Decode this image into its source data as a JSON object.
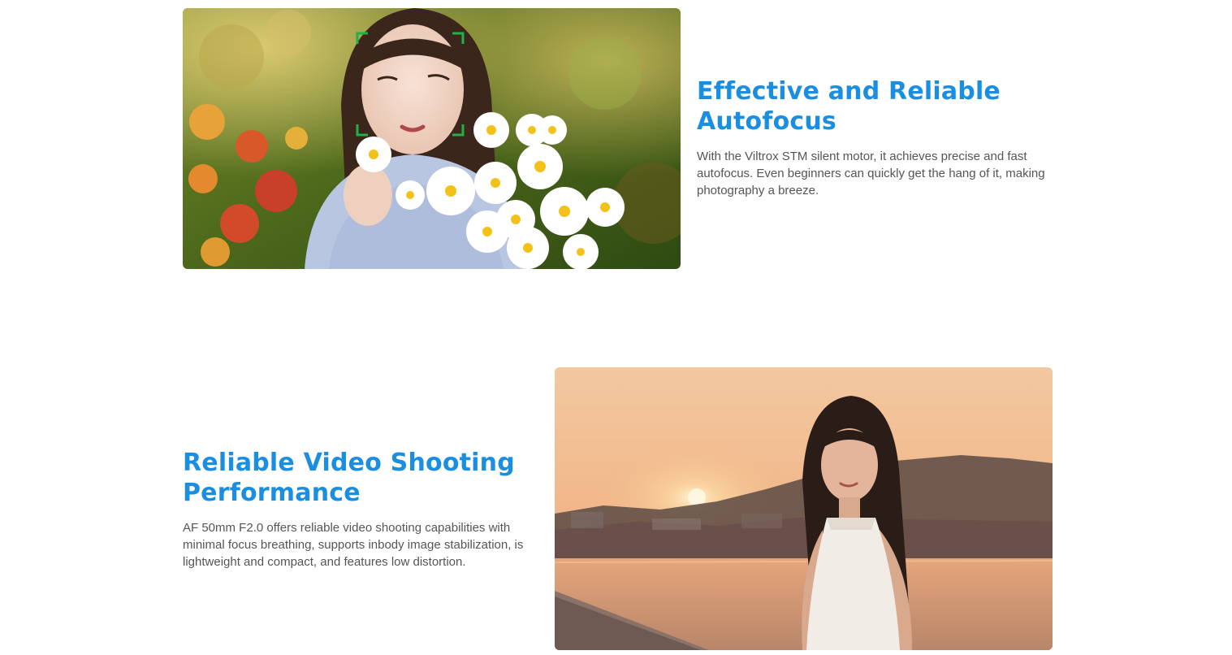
{
  "sections": [
    {
      "title": "Effective and Reliable Autofocus",
      "description": "With the Viltrox STM silent motor, it achieves precise and fast autofocus. Even beginners can quickly get the hang of it, making photography a breeze.",
      "image": "portrait-with-daisies-photo",
      "accent_color": "#1a8ee0"
    },
    {
      "title": "Reliable Video Shooting Performance",
      "description": "AF 50mm F2.0 offers reliable video shooting capabilities with minimal focus breathing, supports inbody image stabilization, is lightweight and compact, and features low distortion.",
      "image": "sunset-seaside-portrait-photo",
      "accent_color": "#1a8ee0"
    }
  ],
  "colors": {
    "title": "#1a8ee0",
    "body_text": "#555555",
    "af_frame": "#22b04b",
    "background": "#ffffff"
  }
}
